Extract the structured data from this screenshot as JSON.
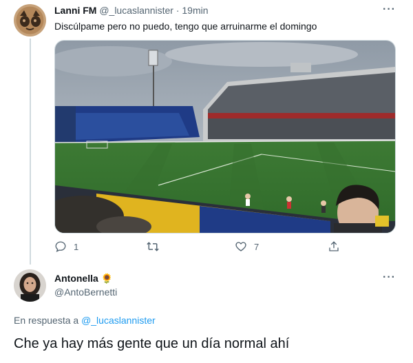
{
  "tweet1": {
    "display_name": "Lanni FM",
    "handle": "@_lucaslannister",
    "separator": "·",
    "time": "19min",
    "text": "Discúlpame pero no puedo, tengo que arruinarme el domingo",
    "more_icon": "more-dots-icon",
    "actions": {
      "reply_count": "1",
      "retweet_count": "",
      "like_count": "7"
    }
  },
  "tweet2": {
    "display_name": "Antonella",
    "emoji": "🌻",
    "handle": "@AntoBernetti",
    "reply_prefix": "En respuesta a",
    "reply_to": "@_lucaslannister",
    "text": "Che ya hay más gente que un día normal ahí",
    "more_icon": "more-dots-icon"
  },
  "icons": {
    "reply": "reply-icon",
    "retweet": "retweet-icon",
    "like": "heart-icon",
    "share": "share-icon"
  },
  "colors": {
    "accent": "#1d9bf0",
    "muted": "#536471",
    "text": "#0f1419"
  }
}
